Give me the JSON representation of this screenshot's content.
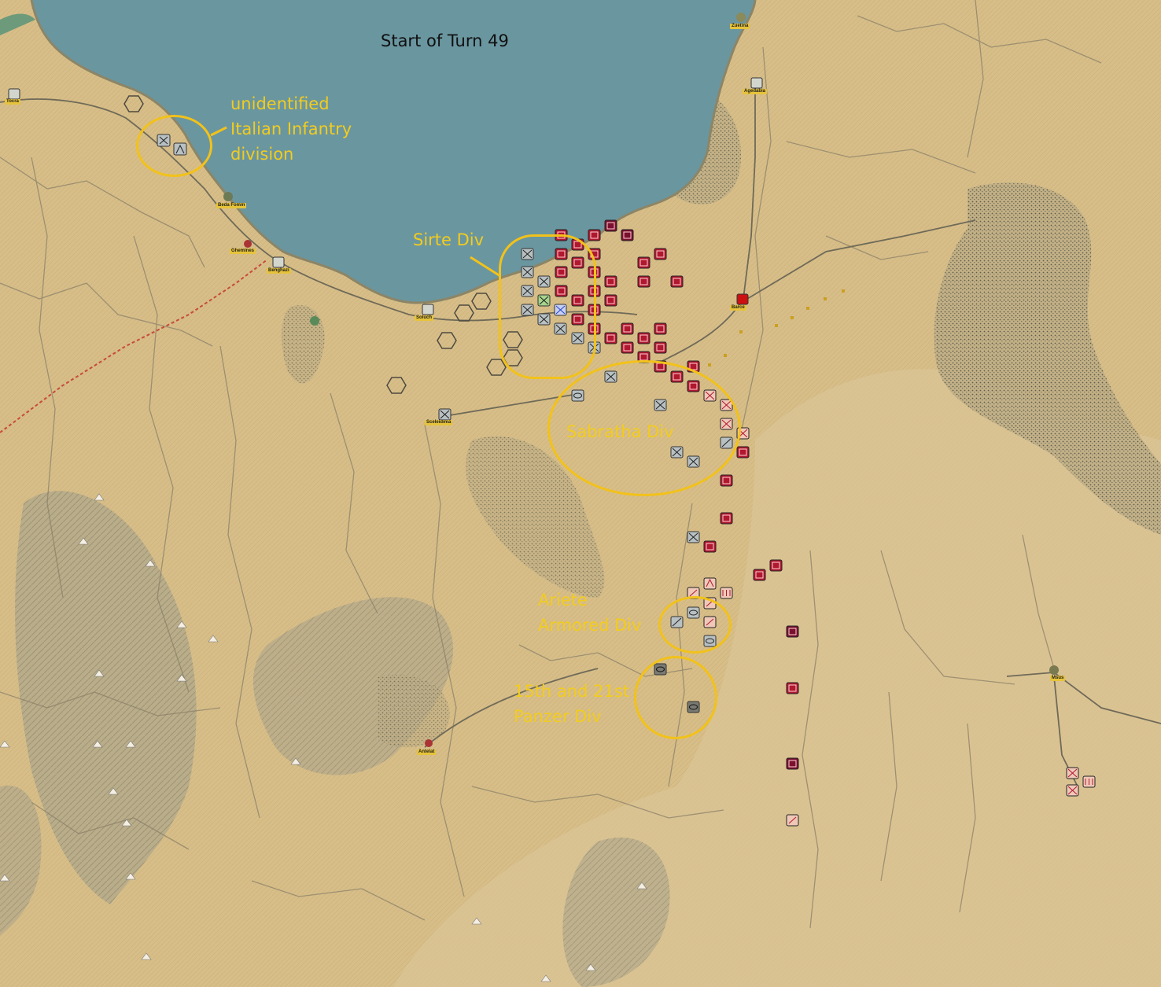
{
  "map": {
    "colors": {
      "sea": "#6a96a0",
      "desert": "#d6bd88",
      "ridge": "#a8a183",
      "scrub": "#55594a",
      "road": "#7d7663",
      "rail": "#c84a3a",
      "annotation": "#f2c21a",
      "axis_unit": "#b8c0c2",
      "allied_unit": "#b01830"
    },
    "turn_title": "Start of Turn 49"
  },
  "annotations": [
    {
      "id": "italian-inf",
      "text": "unidentified\nItalian Infantry\ndivision"
    },
    {
      "id": "sirte",
      "text": "Sirte Div"
    },
    {
      "id": "sabratha",
      "text": "Sabratha Div"
    },
    {
      "id": "ariete",
      "text": "Ariete\nArmored Div"
    },
    {
      "id": "panzer",
      "text": "15th and 21st\nPanzer Div"
    }
  ],
  "towns": [
    "Zuetina",
    "Agedabia",
    "Beda Fomm",
    "Msus",
    "Antelat",
    "Ghemines",
    "Benghazi",
    "Soluch",
    "Sceleidima",
    "Tocra",
    "Barce"
  ],
  "axis_units": [
    {
      "type": "infantry"
    },
    {
      "type": "infantry"
    },
    {
      "type": "infantry"
    },
    {
      "type": "infantry"
    },
    {
      "type": "motorized"
    },
    {
      "type": "infantry"
    },
    {
      "type": "armor"
    },
    {
      "type": "armor"
    },
    {
      "type": "recon"
    },
    {
      "type": "infantry"
    },
    {
      "type": "infantry"
    },
    {
      "type": "infantry"
    }
  ],
  "allied_units": [
    {
      "type": "infantry"
    },
    {
      "type": "infantry"
    },
    {
      "type": "artillery"
    },
    {
      "type": "armor"
    },
    {
      "type": "infantry"
    },
    {
      "type": "motorized"
    },
    {
      "type": "infantry"
    },
    {
      "type": "armor"
    }
  ]
}
